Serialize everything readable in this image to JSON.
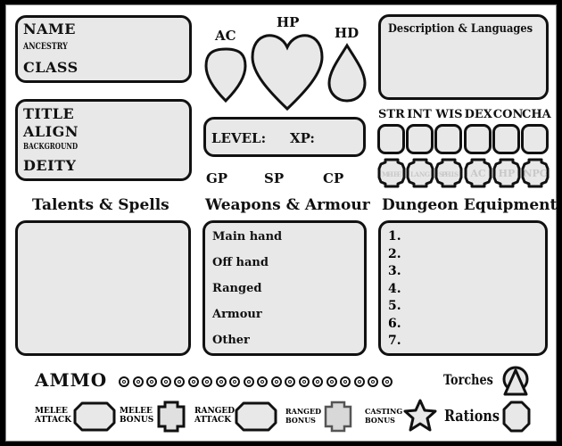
{
  "identity_box": {
    "name_label": "NAME",
    "ancestry_label": "ANCESTRY",
    "class_label": "CLASS"
  },
  "profile_box": {
    "title_label": "TITLE",
    "align_label": "ALIGN",
    "background_label": "BACKGROUND",
    "deity_label": "DEITY"
  },
  "vitals": {
    "ac_label": "AC",
    "hp_label": "HP",
    "hd_label": "HD"
  },
  "level_box": {
    "level_label": "LEVEL:",
    "xp_label": "XP:"
  },
  "coins": {
    "gp_label": "GP",
    "sp_label": "SP",
    "cp_label": "CP"
  },
  "description": {
    "title": "Description & Languages"
  },
  "stats": [
    {
      "label": "STR",
      "modifier_hint": "MELEE"
    },
    {
      "label": "INT",
      "modifier_hint": "LANG"
    },
    {
      "label": "WIS",
      "modifier_hint": "SPELLS"
    },
    {
      "label": "DEX",
      "modifier_hint": "AC"
    },
    {
      "label": "CON",
      "modifier_hint": "HP"
    },
    {
      "label": "CHA",
      "modifier_hint": "NPC"
    }
  ],
  "sections": {
    "talents_title": "Talents & Spells",
    "weapons_title": "Weapons & Armour",
    "equipment_title": "Dungeon Equipment"
  },
  "weapons": [
    "Main hand",
    "Off hand",
    "Ranged",
    "Armour",
    "Other"
  ],
  "equipment": [
    "1.",
    "2.",
    "3.",
    "4.",
    "5.",
    "6.",
    "7."
  ],
  "ammo": {
    "label": "AMMO",
    "count": 20
  },
  "torches_label": "Torches",
  "rations_label": "Rations",
  "bonuses": {
    "melee_attack": [
      "MELEE",
      "ATTACK"
    ],
    "melee_bonus": [
      "MELEE",
      "BONUS"
    ],
    "ranged_attack": [
      "RANGED",
      "ATTACK"
    ],
    "ranged_bonus": [
      "RANGED",
      "BONUS"
    ],
    "casting_bonus": [
      "CASTING",
      "BONUS"
    ]
  },
  "colors": {
    "background": "#000000",
    "sheet": "#ffffff",
    "field_fill": "#e8e8e8",
    "ink": "#111111",
    "ghost_text": "#c8c8c8"
  }
}
